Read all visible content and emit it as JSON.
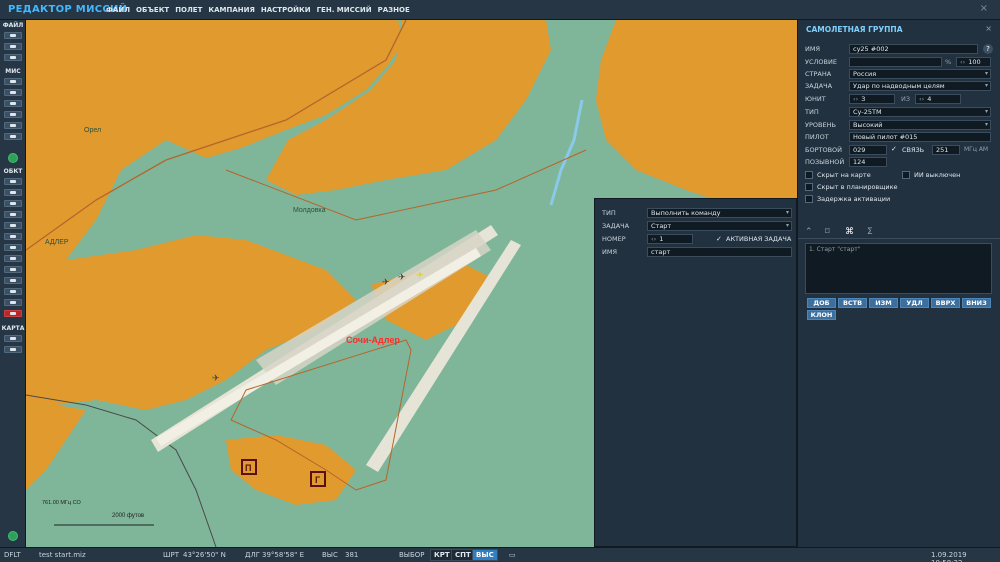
{
  "app": {
    "title": "РЕДАКТОР МИССИЙ",
    "close": "×",
    "menu": [
      "ФАЙЛ",
      "ОБЪЕКТ",
      "ПОЛЕТ",
      "КАМПАНИЯ",
      "НАСТРОЙКИ",
      "ГЕН. МИССИЙ",
      "РАЗНОЕ"
    ]
  },
  "toolbar": {
    "sections": [
      "ФАЙЛ",
      "МИС",
      "ОБКТ",
      "КАРТА"
    ]
  },
  "map": {
    "airfield_name": "Сочи-Адлер",
    "town_labels": [
      "Орел",
      "Молдовка",
      "АДЛЕР"
    ],
    "freq_label": "761.00 МГц СО",
    "scale_label": "2000 футов",
    "zone_markers": [
      "П",
      "Г"
    ]
  },
  "statusbar": {
    "profile": "DFLT",
    "file": "test start.miz",
    "lat_label": "ШРТ",
    "lat": "43°26'50\" N",
    "lon_label": "ДЛГ",
    "lon": "39°58'58\" E",
    "alt_label": "ВЫС",
    "alt": "381",
    "select_label": "ВЫБОР",
    "btn_map": "КРТ",
    "btn_sat": "СПТ",
    "btn_alt": "ВЫС",
    "datetime": "1.09.2019 10:58:22"
  },
  "group_panel": {
    "title": "САМОЛЕТНАЯ ГРУППА",
    "close": "×",
    "help": "?",
    "name_label": "ИМЯ",
    "name_value": "су25 #002",
    "condition_label": "УСЛОВИЕ",
    "condition_value": "",
    "percent_sign": "%",
    "percent_value": "100",
    "country_label": "СТРАНА",
    "country_value": "Россия",
    "task_label": "ЗАДАЧА",
    "task_value": "Удар по надводным целям",
    "unit_label": "ЮНИТ",
    "unit_value": "3",
    "of_label": "ИЗ",
    "unit_total": "4",
    "type_label": "ТИП",
    "type_value": "Су-25ТМ",
    "skill_label": "УРОВЕНЬ",
    "skill_value": "Высокий",
    "pilot_label": "ПИЛОТ",
    "pilot_value": "Новый пилот #015",
    "tail_label": "БОРТОВОЙ",
    "tail_value": "029",
    "radio_label": "СВЯЗЬ",
    "radio_value": "251",
    "radio_unit": "МГц АМ",
    "callsign_label": "ПОЗЫВНОЙ",
    "callsign_value": "124",
    "chk_hidden_map": "Скрыт на карте",
    "chk_ai_off": "ИИ выключен",
    "chk_hidden_planner": "Скрыт в планировщике",
    "chk_late_activation": "Задержка активации",
    "tabs": [
      "⌃",
      "⌑",
      "⌘",
      "Σ"
    ],
    "action_item": "1. Старт \"старт\"",
    "buttons": [
      "ДОБ",
      "ВСТВ",
      "ИЗМ",
      "УДЛ",
      "ВВРХ",
      "ВНИЗ",
      "КЛОН"
    ]
  },
  "action_panel": {
    "type_label": "ТИП",
    "type_value": "Выполнить команду",
    "task_label": "ЗАДАЧА",
    "task_value": "Старт",
    "number_label": "НОМЕР",
    "number_value": "1",
    "active_label": "АКТИВНАЯ ЗАДАЧА",
    "name_label": "ИМЯ",
    "name_value": "старт"
  },
  "colors": {
    "accent": "#42b8ff",
    "urban": "#e09a2e",
    "terrain": "#7fb69a",
    "runway": "#e6e4d6",
    "airfield_label": "#ff2a2a"
  }
}
